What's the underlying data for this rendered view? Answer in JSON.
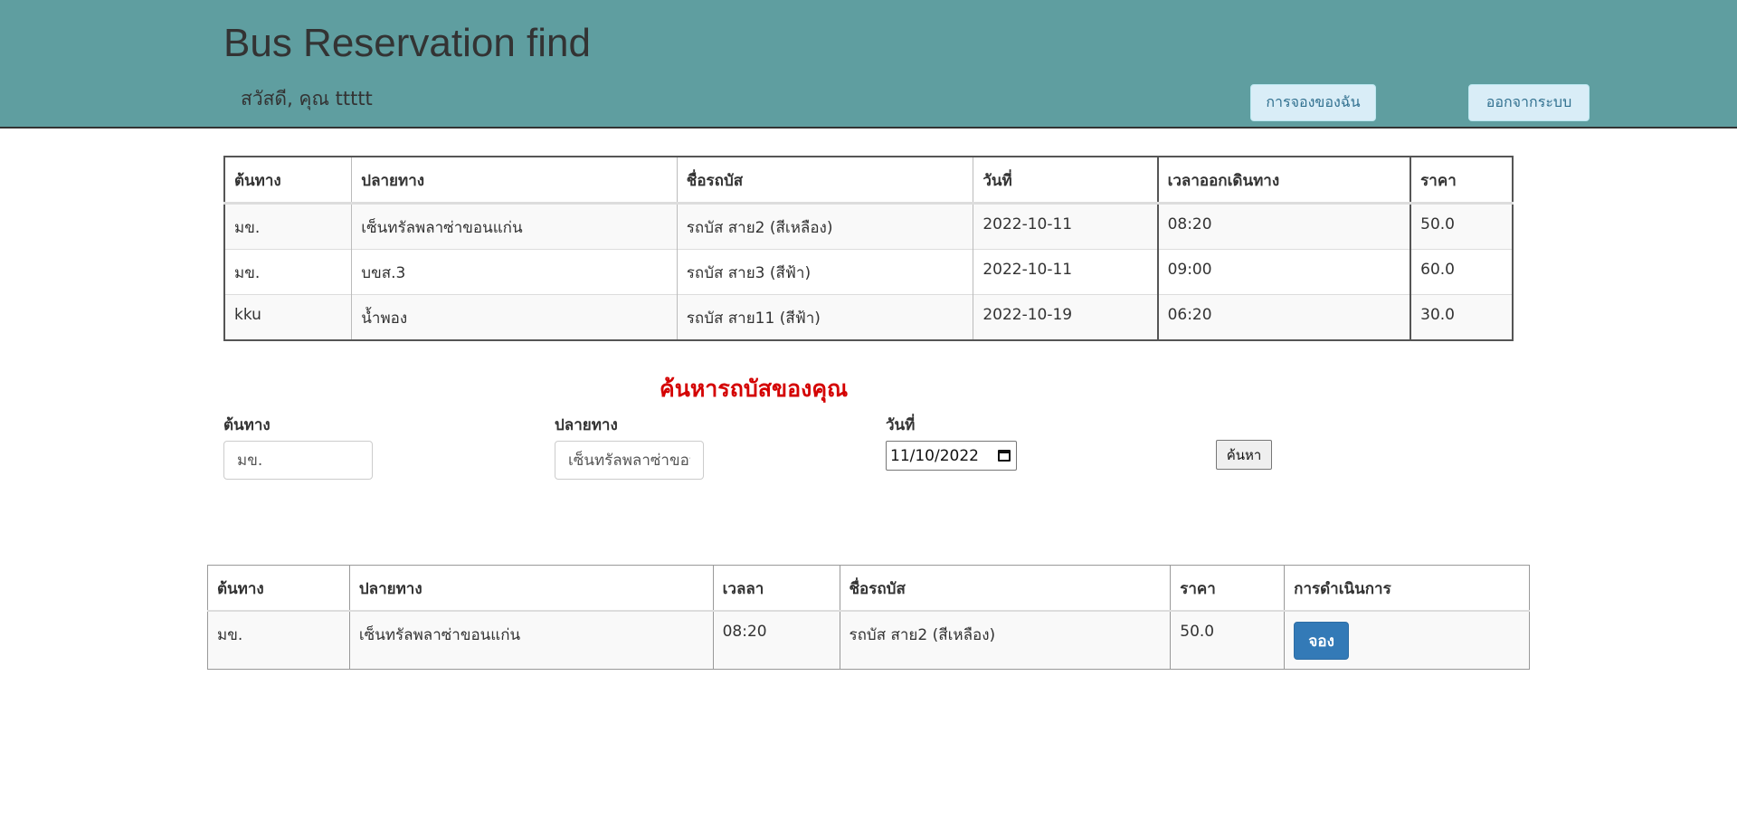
{
  "header": {
    "title": "Bus Reservation find",
    "greeting": "สวัสดี, คุณ ttttt",
    "my_bookings_label": "การจองของฉัน",
    "logout_label": "ออกจากระบบ"
  },
  "routes_table": {
    "headers": {
      "origin": "ต้นทาง",
      "destination": "ปลายทาง",
      "bus_name": "ชื่อรถบัส",
      "date": "วันที่",
      "departure_time": "เวลาออกเดินทาง",
      "price": "ราคา"
    },
    "rows": [
      {
        "origin": "มข.",
        "destination": "เซ็นทรัลพลาซ่าขอนแก่น",
        "bus_name": "รถบัส สาย2 (สีเหลือง)",
        "date": "2022-10-11",
        "departure_time": "08:20",
        "price": "50.0"
      },
      {
        "origin": "มข.",
        "destination": "บขส.3",
        "bus_name": "รถบัส สาย3 (สีฟ้า)",
        "date": "2022-10-11",
        "departure_time": "09:00",
        "price": "60.0"
      },
      {
        "origin": "kku",
        "destination": "น้ำพอง",
        "bus_name": "รถบัส สาย11 (สีฟ้า)",
        "date": "2022-10-19",
        "departure_time": "06:20",
        "price": "30.0"
      }
    ]
  },
  "search": {
    "title": "ค้นหารถบัสของคุณ",
    "origin_label": "ต้นทาง",
    "origin_value": "มข.",
    "destination_label": "ปลายทาง",
    "destination_value": "เซ็นทรัลพลาซ่าขอนแก่น",
    "date_label": "วันที่",
    "date_value": "11/10/2022",
    "search_button_label": "ค้นหา"
  },
  "results_table": {
    "headers": {
      "origin": "ต้นทาง",
      "destination": "ปลายทาง",
      "time": "เวลลา",
      "bus_name": "ชื่อรถบัส",
      "price": "ราคา",
      "action": "การดำเนินการ"
    },
    "rows": [
      {
        "origin": "มข.",
        "destination": "เซ็นทรัลพลาซ่าขอนแก่น",
        "time": "08:20",
        "bus_name": "รถบัส สาย2 (สีเหลือง)",
        "price": "50.0",
        "action_label": "จอง"
      }
    ]
  },
  "colors": {
    "header_bg": "#5f9ea0",
    "search_title": "#d40000",
    "primary_button": "#337ab7",
    "info_button": "#d9edf7"
  },
  "icons": {
    "date_picker": "calendar-icon"
  }
}
